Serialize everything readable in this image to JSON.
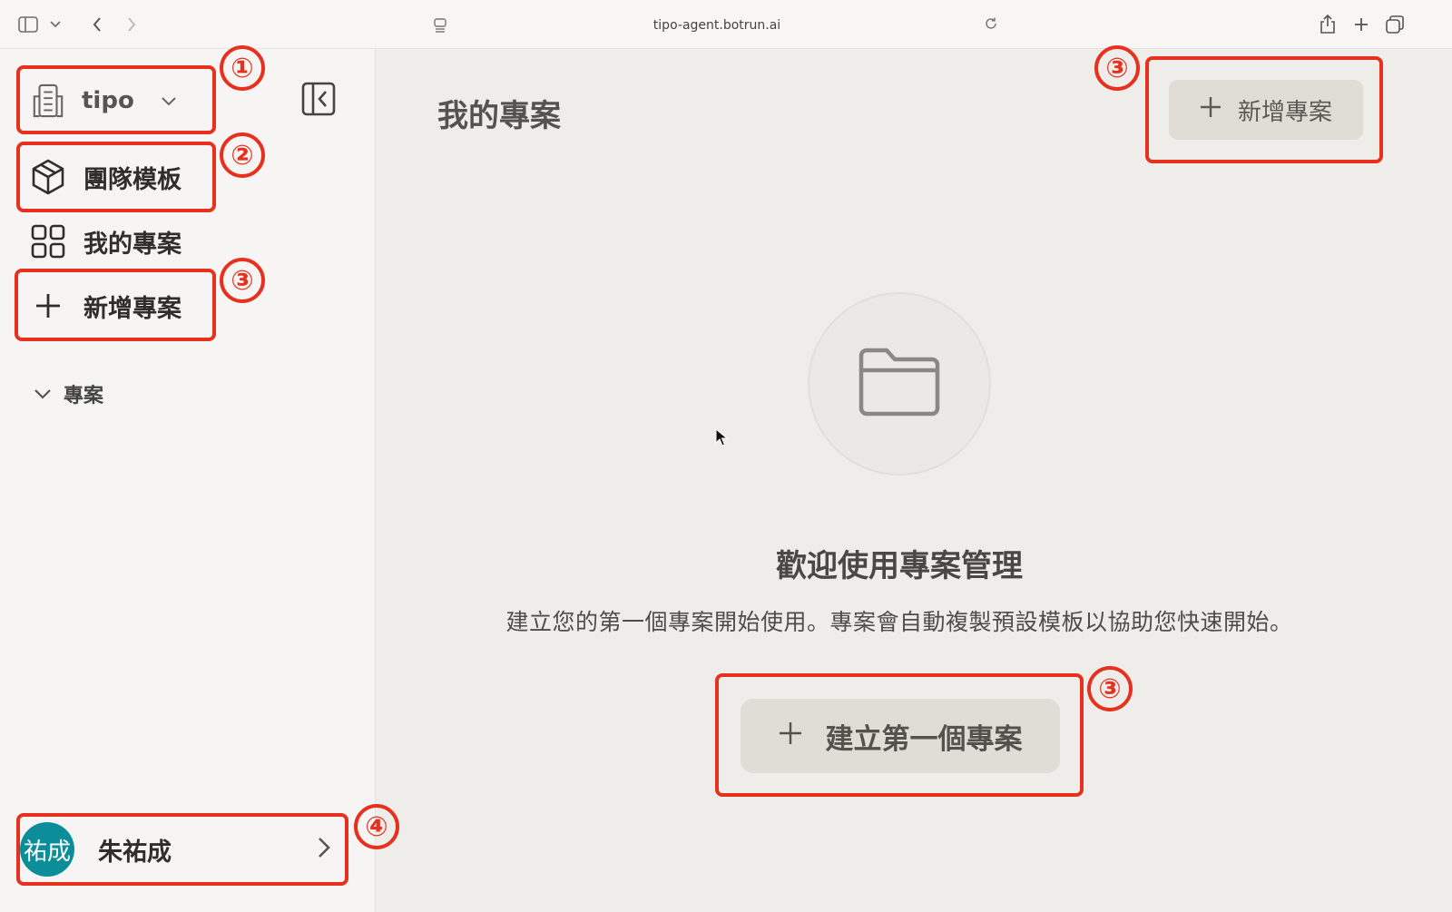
{
  "browser": {
    "url": "tipo-agent.botrun.ai",
    "icons": [
      "sidebar-toggle-icon",
      "chevron-down-icon",
      "back-icon",
      "forward-icon",
      "reader-icon",
      "reload-icon",
      "share-icon",
      "new-tab-icon",
      "tabs-overview-icon"
    ]
  },
  "sidebar": {
    "workspace_name": "tipo",
    "nav": [
      {
        "label": "團隊模板",
        "icon": "cube-icon"
      },
      {
        "label": "我的專案",
        "icon": "grid-icon"
      },
      {
        "label": "新增專案",
        "icon": "plus-icon"
      }
    ],
    "section_label": "專案",
    "user": {
      "avatar_text": "祐成",
      "name": "朱祐成"
    }
  },
  "main": {
    "page_title": "我的專案",
    "add_button_label": "新增專案",
    "empty_title": "歡迎使用專案管理",
    "empty_description": "建立您的第一個專案開始使用。專案會自動複製預設模板以協助您快速開始。",
    "cta_label": "建立第一個專案"
  },
  "annotations": {
    "n1": "①",
    "n2": "②",
    "n3": "③",
    "n4": "④"
  },
  "colors": {
    "highlight": "#e8301e",
    "avatar": "#0b8e9a",
    "button_bg": "#e0dcd6"
  }
}
